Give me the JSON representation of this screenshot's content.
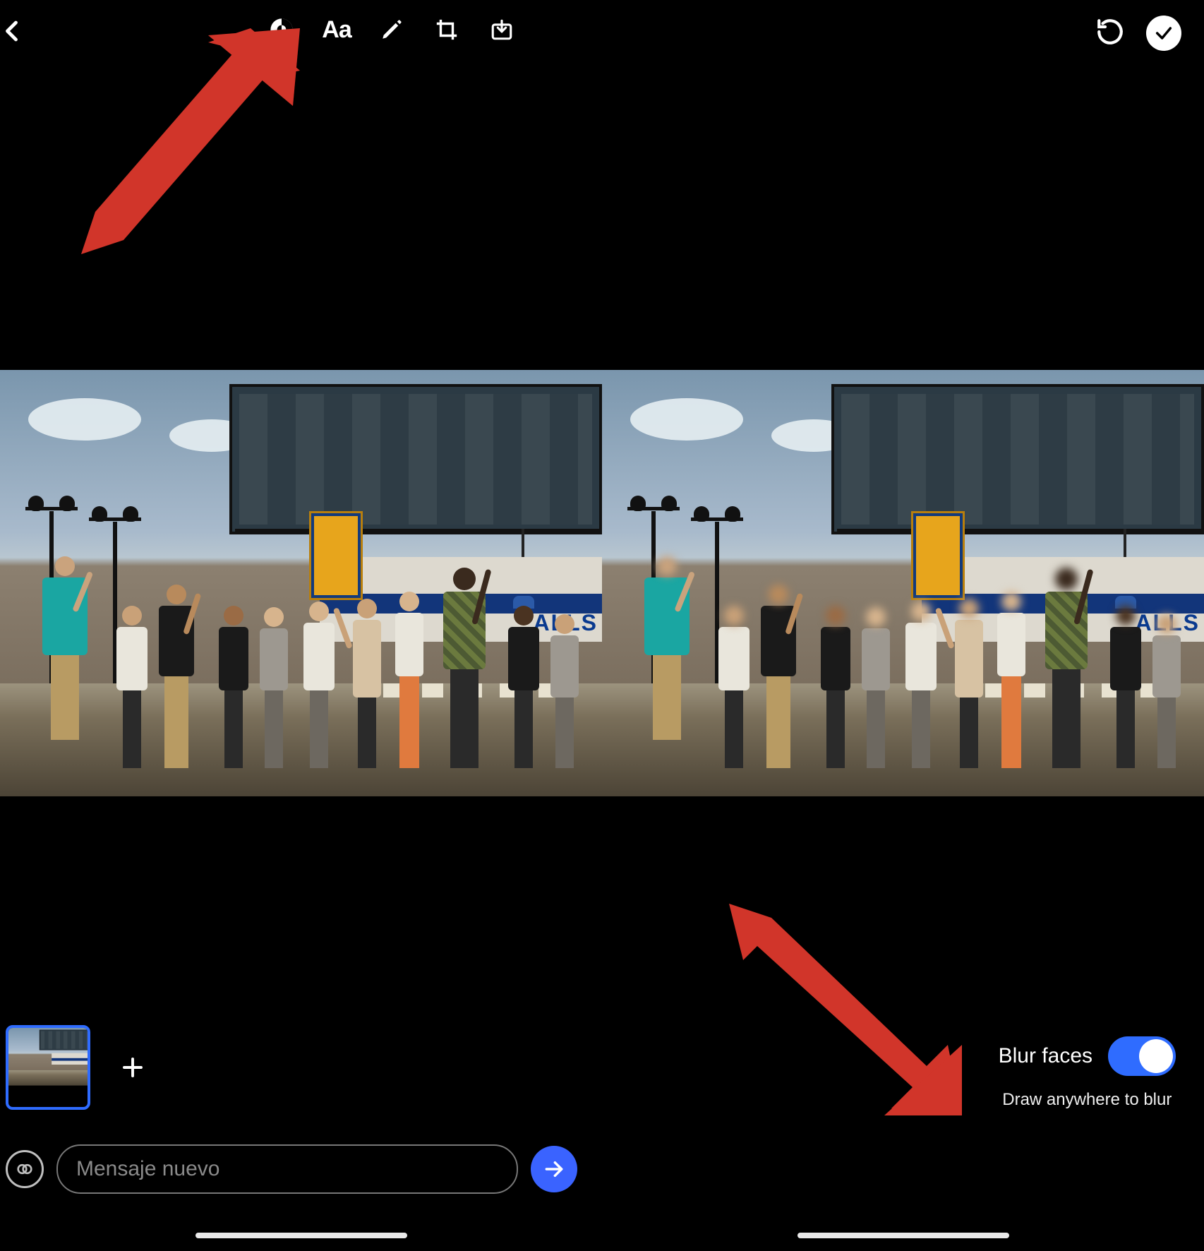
{
  "toolbar": {
    "text_tool_label": "Aa"
  },
  "truck_text": "ALLS",
  "thumb_add": "+",
  "message": {
    "placeholder": "Mensaje nuevo"
  },
  "blur": {
    "label": "Blur faces",
    "hint": "Draw anywhere to blur",
    "enabled": true
  },
  "colors": {
    "accent": "#2f6cff",
    "annotation": "#d1352a"
  }
}
